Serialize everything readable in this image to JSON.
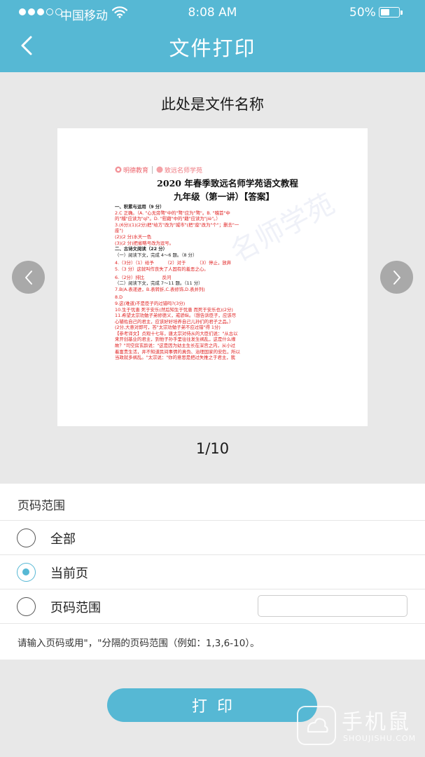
{
  "status_bar": {
    "carrier": "中国移动",
    "time": "8:08 AM",
    "battery_percent": "50%",
    "battery_level": 0.5
  },
  "header": {
    "title": "文件打印"
  },
  "file": {
    "name": "此处是文件名称"
  },
  "preview": {
    "logo_left": "明德教育",
    "logo_right": "致远名师学苑",
    "watermark": "名师学苑",
    "title_line1": "2020 年春季致远名师学苑语文教程",
    "title_line2": "九年级（第一讲）【答案】",
    "lines": [
      {
        "text": "一、积累与运用（9 分）",
        "style": "black bold"
      },
      {
        "text": "2.C 正确。（A. \"心无旁骛\"中的\"骛\"应为\"骛\"。B. \"稽首\"中",
        "style": "red"
      },
      {
        "text": "的\"稽\"应读为\"qǐ\"。D. \"慰藉\"中的\"藉\"应读为\"jiè\"。）",
        "style": "red"
      },
      {
        "text": "3.(6分)(1)(2分)把\"给方\"改为\"城市\"(把\"座\"改为\"个\"；删去\"一",
        "style": "red"
      },
      {
        "text": "座\")",
        "style": "red"
      },
      {
        "text": "(2)(2 分)水天一色",
        "style": "red"
      },
      {
        "text": "(3)(2 分)把省略号改为逗号。",
        "style": "red"
      },
      {
        "text": "二、古诗文阅读（22 分）",
        "style": "black bold"
      },
      {
        "text": "（一）阅读下文，完成 4～6 题。（8 分）",
        "style": "black"
      },
      {
        "text": "4.（3分）（1）给予　　　（2）对于　　　（3）停止，放弃",
        "style": "red gap"
      },
      {
        "text": "5.（3 分）这就叫作丧失了人固有的羞恶之心。",
        "style": "red"
      },
      {
        "text": "6.（2分）排比　　　　反问",
        "style": "red gap"
      },
      {
        "text": "（二）阅读下文，完成 7～11 题。（11 分）",
        "style": "black"
      },
      {
        "text": "7.B(A.表递进，B.表转折,C.表修饰,D.表并列)",
        "style": "red"
      },
      {
        "text": "8.D",
        "style": "red gap"
      },
      {
        "text": "9.这(难道)不是臣子的过错吗?(3分)",
        "style": "red"
      },
      {
        "text": "10.生于忧患 死于安乐(然后知生于忧患 而死于安乐也)(2分)",
        "style": "red"
      },
      {
        "text": "11.希望太宗劝勉子弟修德义，戒骄纵。（想告诉臣子，应该尽",
        "style": "red"
      },
      {
        "text": "心辅佐自己的君主，应该好好培养自己儿孙们的君子之品。）",
        "style": "red"
      },
      {
        "text": "(2分,大意对即可，答\"太宗劝勉子弟不应过错\"得 1分)",
        "style": "red"
      },
      {
        "text": "【参考译文】贞观十七年，唐太宗对侍从的大臣们说：\"从古以",
        "style": "red"
      },
      {
        "text": "来开创基业的君主，到他子孙手里往往发生祸乱，这是什么缘",
        "style": "red"
      },
      {
        "text": "故？\"司空房玄龄说：\"这是因为幼主生长在深宫之内，从小过",
        "style": "red"
      },
      {
        "text": "着富贵生活，并不知道民间事情的真伪、治理国家的安危，所以",
        "style": "red"
      },
      {
        "text": "当政就多祸乱。\"太宗说：\"你的意思是把过失推之于君主，我",
        "style": "red"
      }
    ]
  },
  "pagination": {
    "indicator": "1/10"
  },
  "page_range": {
    "header": "页码范围",
    "options": [
      {
        "label": "全部",
        "selected": false
      },
      {
        "label": "当前页",
        "selected": true
      },
      {
        "label": "页码范围",
        "selected": false
      }
    ],
    "custom_value": "",
    "hint": "请输入页码或用\"，\"分隔的页码范围（例如：1,3,6-10）。"
  },
  "print_button": {
    "label": "打印"
  },
  "site_watermark": {
    "cn": "手机鼠",
    "en": "SHOUJISHU.COM"
  },
  "colors": {
    "accent": "#56b8d4",
    "background": "#e8e8e8",
    "doc_red": "#e02020"
  }
}
